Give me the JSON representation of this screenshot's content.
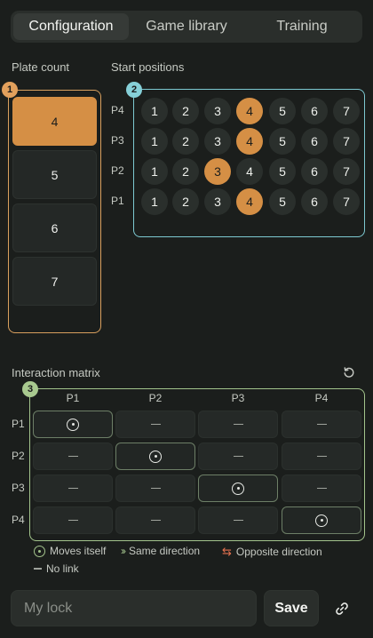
{
  "tabs": [
    {
      "label": "Configuration",
      "active": true
    },
    {
      "label": "Game library",
      "active": false
    },
    {
      "label": "Training",
      "active": false
    }
  ],
  "plate_count": {
    "label": "Plate count",
    "badge": "1",
    "options": [
      "4",
      "5",
      "6",
      "7"
    ],
    "selected": "4"
  },
  "start_positions": {
    "label": "Start positions",
    "badge": "2",
    "positions": [
      "1",
      "2",
      "3",
      "4",
      "5",
      "6",
      "7"
    ],
    "rows": [
      {
        "label": "P4",
        "selected": "4"
      },
      {
        "label": "P3",
        "selected": "4"
      },
      {
        "label": "P2",
        "selected": "3"
      },
      {
        "label": "P1",
        "selected": "4"
      }
    ]
  },
  "interaction_matrix": {
    "label": "Interaction matrix",
    "badge": "3",
    "reset_icon": "reset-icon",
    "columns": [
      "P1",
      "P2",
      "P3",
      "P4"
    ],
    "rows": [
      {
        "label": "P1",
        "cells": [
          "self",
          "none",
          "none",
          "none"
        ]
      },
      {
        "label": "P2",
        "cells": [
          "none",
          "self",
          "none",
          "none"
        ]
      },
      {
        "label": "P3",
        "cells": [
          "none",
          "none",
          "self",
          "none"
        ]
      },
      {
        "label": "P4",
        "cells": [
          "none",
          "none",
          "none",
          "self"
        ]
      }
    ]
  },
  "legend": {
    "moves_itself": "Moves itself",
    "same_direction": "Same direction",
    "opposite_direction": "Opposite direction",
    "no_link": "No link"
  },
  "bottom": {
    "lock_placeholder": "My lock",
    "lock_value": "",
    "save_label": "Save",
    "link_icon": "link-icon"
  },
  "colors": {
    "accent_orange": "#d58f45",
    "panel1_border": "#d9a05e",
    "panel2_border": "#7dc9d1",
    "panel3_border": "#a3c48c",
    "opposite_arrow": "#e2704e"
  }
}
